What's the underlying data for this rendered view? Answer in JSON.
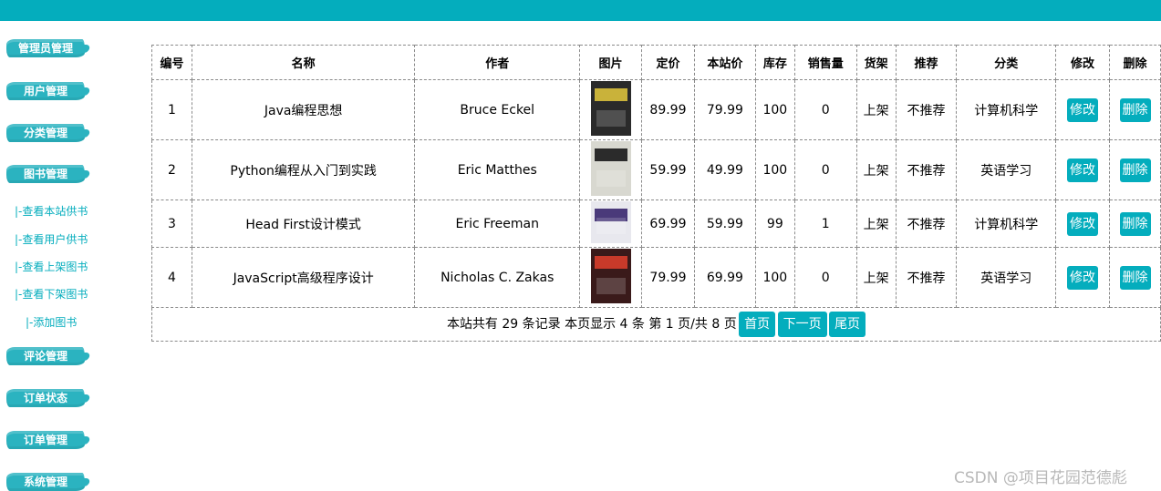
{
  "sidebar": {
    "menus": [
      {
        "label": "管理员管理"
      },
      {
        "label": "用户管理"
      },
      {
        "label": "分类管理"
      },
      {
        "label": "图书管理"
      },
      {
        "label": "评论管理"
      },
      {
        "label": "订单状态"
      },
      {
        "label": "订单管理"
      },
      {
        "label": "系统管理"
      }
    ],
    "book_sublinks": [
      {
        "label": "|-查看本站供书"
      },
      {
        "label": "|-查看用户供书"
      },
      {
        "label": "|-查看上架图书"
      },
      {
        "label": "|-查看下架图书"
      },
      {
        "label": "|-添加图书"
      }
    ]
  },
  "table": {
    "headers": [
      "编号",
      "名称",
      "作者",
      "图片",
      "定价",
      "本站价",
      "库存",
      "销售量",
      "货架",
      "推荐",
      "分类",
      "修改",
      "删除"
    ],
    "rows": [
      {
        "id": "1",
        "name": "Java编程思想",
        "author": "Bruce Eckel",
        "price": "89.99",
        "site_price": "79.99",
        "stock": "100",
        "sold": "0",
        "shelf": "上架",
        "recommend": "不推荐",
        "category": "计算机科学",
        "edit": "修改",
        "delete": "删除",
        "cover_color": "#2a2a2a",
        "cover_accent": "#c9b23a"
      },
      {
        "id": "2",
        "name": "Python编程从入门到实践",
        "author": "Eric Matthes",
        "price": "59.99",
        "site_price": "49.99",
        "stock": "100",
        "sold": "0",
        "shelf": "上架",
        "recommend": "不推荐",
        "category": "英语学习",
        "edit": "修改",
        "delete": "删除",
        "cover_color": "#d8d8d0",
        "cover_accent": "#2b2b2b"
      },
      {
        "id": "3",
        "name": "Head First设计模式",
        "author": "Eric Freeman",
        "price": "69.99",
        "site_price": "59.99",
        "stock": "99",
        "sold": "1",
        "shelf": "上架",
        "recommend": "不推荐",
        "category": "计算机科学",
        "edit": "修改",
        "delete": "删除",
        "cover_color": "#e8e8ee",
        "cover_accent": "#4a3a7a"
      },
      {
        "id": "4",
        "name": "JavaScript高级程序设计",
        "author": "Nicholas C. Zakas",
        "price": "79.99",
        "site_price": "69.99",
        "stock": "100",
        "sold": "0",
        "shelf": "上架",
        "recommend": "不推荐",
        "category": "英语学习",
        "edit": "修改",
        "delete": "删除",
        "cover_color": "#3a1a1a",
        "cover_accent": "#c83a2a"
      }
    ]
  },
  "pager": {
    "summary": "本站共有 29 条记录 本页显示 4 条 第 1 页/共 8 页",
    "first": "首页",
    "next": "下一页",
    "last": "尾页"
  },
  "watermark": "CSDN @项目花园范德彪",
  "colors": {
    "accent": "#04adbd"
  }
}
